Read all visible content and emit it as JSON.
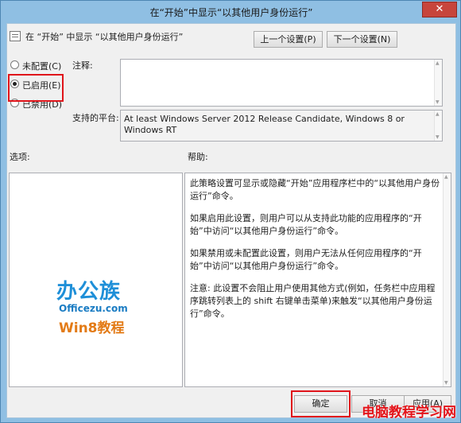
{
  "window": {
    "title": "在“开始”中显示“以其他用户身份运行”",
    "close_glyph": "✕"
  },
  "header": {
    "setting_name": "在 “开始” 中显示 “以其他用户身份运行”",
    "prev_button": "上一个设置(P)",
    "next_button": "下一个设置(N)"
  },
  "options": [
    {
      "label": "未配置(C)",
      "checked": false
    },
    {
      "label": "已启用(E)",
      "checked": true
    },
    {
      "label": "已禁用(D)",
      "checked": false
    }
  ],
  "comment": {
    "label": "注释:",
    "value": ""
  },
  "supported": {
    "label": "支持的平台:",
    "value": "At least Windows Server 2012 Release Candidate, Windows 8 or Windows RT"
  },
  "options_panel": {
    "label": "选项:"
  },
  "help_panel": {
    "label": "帮助:",
    "paragraphs": [
      "此策略设置可显示或隐藏“开始”应用程序栏中的“以其他用户身份运行”命令。",
      "如果启用此设置，则用户可以从支持此功能的应用程序的“开始”中访问“以其他用户身份运行”命令。",
      "如果禁用或未配置此设置，则用户无法从任何应用程序的“开始”中访问“以其他用户身份运行”命令。",
      "注意: 此设置不会阻止用户使用其他方式(例如，任务栏中应用程序跳转列表上的 shift 右键单击菜单)来触发“以其他用户身份运行”命令。"
    ]
  },
  "footer": {
    "ok_button": "确定",
    "cancel_button": "取消",
    "apply_button": "应用(A)"
  },
  "branding": {
    "logo_main": "办公族",
    "logo_url": "Officezu.com",
    "logo_sub": "Win8教程",
    "watermark": "电脑教程学习网"
  },
  "colors": {
    "highlight": "#e0141a",
    "close": "#c7453c",
    "logo_blue": "#1e8fd8",
    "logo_orange": "#e37b17"
  }
}
